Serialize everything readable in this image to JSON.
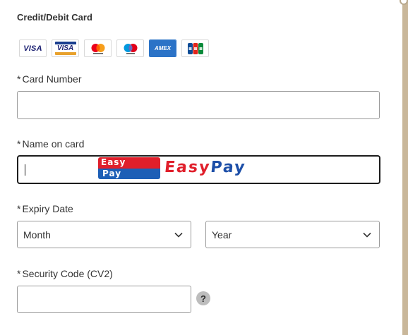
{
  "section": {
    "title": "Credit/Debit Card"
  },
  "card_logos": [
    {
      "name": "visa",
      "text": "VISA"
    },
    {
      "name": "visa-electron",
      "text": "VISA"
    },
    {
      "name": "mastercard",
      "text": ""
    },
    {
      "name": "maestro",
      "text": ""
    },
    {
      "name": "amex",
      "text": "AMEX"
    },
    {
      "name": "jcb",
      "text": ""
    }
  ],
  "fields": {
    "required_marker": "*",
    "card_number": {
      "label": "Card Number",
      "value": ""
    },
    "name_on_card": {
      "label": "Name on card",
      "value": ""
    },
    "expiry": {
      "label": "Expiry Date",
      "month": "Month",
      "year": "Year"
    },
    "security_code": {
      "label": "Security Code (CV2)",
      "value": "",
      "help": "?"
    }
  },
  "overlay": {
    "logo_top": "Easy",
    "logo_bottom": "Pay",
    "word_part1": "Easy",
    "word_part2": "Pay"
  },
  "colors": {
    "easypay_red": "#e01f2b",
    "easypay_blue": "#1d4fa8",
    "border": "#9a9a9a",
    "focus_border": "#1c1c1c"
  }
}
